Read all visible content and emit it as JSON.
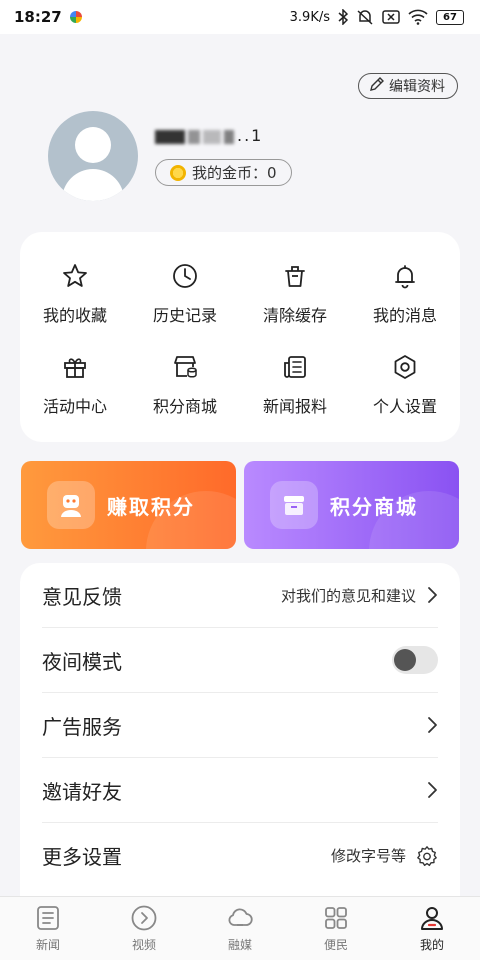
{
  "status_bar": {
    "time": "18:27",
    "speed": "3.9K/s",
    "battery": "67"
  },
  "profile": {
    "edit_label": "编辑资料",
    "username_visible": "..1",
    "coins_label": "我的金币：0"
  },
  "grid": [
    {
      "label": "我的收藏",
      "icon": "star-icon"
    },
    {
      "label": "历史记录",
      "icon": "clock-icon"
    },
    {
      "label": "清除缓存",
      "icon": "trash-icon"
    },
    {
      "label": "我的消息",
      "icon": "bell-icon"
    },
    {
      "label": "活动中心",
      "icon": "gift-icon"
    },
    {
      "label": "积分商城",
      "icon": "store-icon"
    },
    {
      "label": "新闻报料",
      "icon": "news-report-icon"
    },
    {
      "label": "个人设置",
      "icon": "hexagon-settings-icon"
    }
  ],
  "banners": {
    "earn": "赚取积分",
    "mall": "积分商城"
  },
  "list": {
    "feedback": {
      "label": "意见反馈",
      "hint": "对我们的意见和建议"
    },
    "night_mode": {
      "label": "夜间模式",
      "enabled": false
    },
    "ads": {
      "label": "广告服务"
    },
    "invite": {
      "label": "邀请好友"
    },
    "more": {
      "label": "更多设置",
      "hint": "修改字号等"
    }
  },
  "tabs": [
    {
      "label": "新闻",
      "icon": "news-tab-icon"
    },
    {
      "label": "视频",
      "icon": "play-circle-icon"
    },
    {
      "label": "融媒",
      "icon": "cloud-icon"
    },
    {
      "label": "便民",
      "icon": "grid-apps-icon"
    },
    {
      "label": "我的",
      "icon": "user-icon",
      "active": true
    }
  ],
  "colors": {
    "earn_banner": "#ff7a30",
    "mall_banner": "#9a62f5",
    "background": "#f5f5f8"
  }
}
